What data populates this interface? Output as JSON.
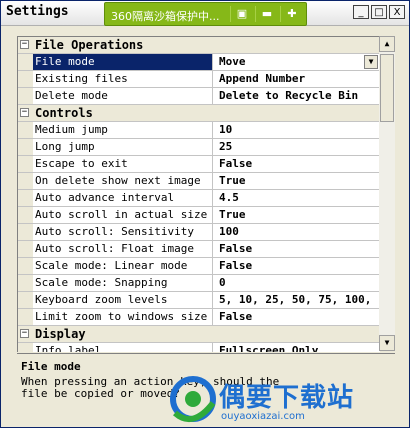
{
  "window": {
    "title": "Settings",
    "controls": [
      "_",
      "□",
      "X"
    ]
  },
  "sandbox_bar": {
    "text": "360隔离沙箱保护中..."
  },
  "categories": [
    {
      "name": "File Operations",
      "expanded": true,
      "rows": [
        {
          "name": "File mode",
          "value": "Move",
          "selected": true,
          "dropdown": true
        },
        {
          "name": "Existing files",
          "value": "Append Number"
        },
        {
          "name": "Delete mode",
          "value": "Delete to Recycle Bin"
        }
      ]
    },
    {
      "name": "Controls",
      "expanded": true,
      "rows": [
        {
          "name": "Medium jump",
          "value": "10"
        },
        {
          "name": "Long jump",
          "value": "25"
        },
        {
          "name": "Escape to exit",
          "value": "False"
        },
        {
          "name": "On delete show next image",
          "value": "True"
        },
        {
          "name": "Auto advance interval",
          "value": "4.5"
        },
        {
          "name": "Auto scroll in actual size",
          "value": "True"
        },
        {
          "name": "Auto scroll: Sensitivity",
          "value": "100"
        },
        {
          "name": "Auto scroll: Float image",
          "value": "False"
        },
        {
          "name": "Scale mode: Linear mode",
          "value": "False"
        },
        {
          "name": "Scale mode: Snapping",
          "value": "0"
        },
        {
          "name": "Keyboard zoom levels",
          "value": "5, 10, 25, 50, 75, 100, 125, 150,"
        },
        {
          "name": "Limit zoom to windows size",
          "value": "False"
        }
      ]
    },
    {
      "name": "Display",
      "expanded": true,
      "rows": [
        {
          "name": "Info label",
          "value": "Fullscreen Only"
        }
      ]
    }
  ],
  "help": {
    "title": "File mode",
    "description": "When pressing an action key, should the file be copied or moved?"
  },
  "watermark": {
    "text": "偶要下载站",
    "url": "ouyaoxiazai.com"
  },
  "colors": {
    "selection": "#0a246a",
    "sandbox": "#86b818",
    "watermark": "#1e6fd0"
  }
}
